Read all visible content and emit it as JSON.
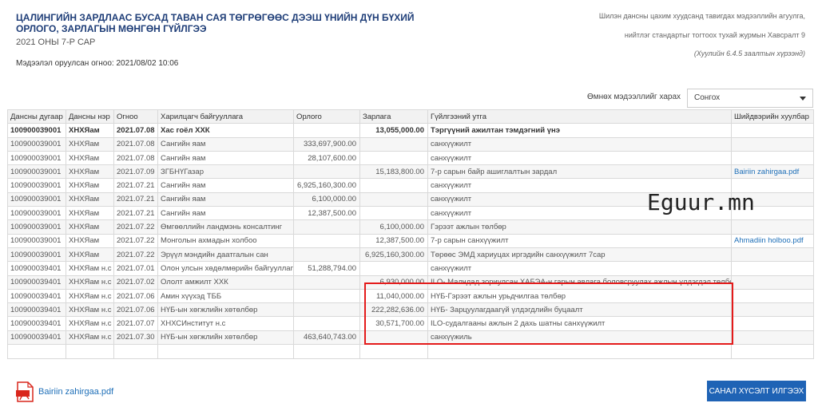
{
  "header": {
    "title": "ЦАЛИНГИЙН ЗАРДЛААС БУСАД ТАВАН САЯ ТӨГРӨГӨӨС ДЭЭШ ҮНИЙН ДҮН БҮХИЙ ОРЛОГО, ЗАРЛАГЫН МӨНГӨН ГҮЙЛГЭЭ",
    "period": "2021 ОНЫ 7-Р САР",
    "entered_date": "Мэдээлэл оруулсан огноо: 2021/08/02 10:06"
  },
  "notes": {
    "line1": "Шилэн дансны цахим хуудсанд тавигдах мэдээллийн агуулга,",
    "line2": "нийтлэг стандартыг тогтоох тухай журмын Хавсралт 9",
    "line3": "(Хуулийн 6.4.5 заалтын хүрээнд)"
  },
  "filter": {
    "label": "Өмнөх мэдээллийг харах",
    "selected": "Сонгох"
  },
  "table": {
    "columns": [
      "Дансны дугаар",
      "Дансны нэр",
      "Огноо",
      "Харилцагч байгууллага",
      "Орлого",
      "Зарлага",
      "Гүйлгээний утга",
      "Шийдвэрийн хуулбар"
    ],
    "rows": [
      {
        "acct": "100900039001",
        "name": "ХНХЯам",
        "date": "2021.07.08",
        "party": "Хас гоёл ХХК",
        "income": "",
        "expense": "13,055,000.00",
        "desc": "Тэргүүний ажилтан тэмдэгний үнэ",
        "doc": ""
      },
      {
        "acct": "100900039001",
        "name": "ХНХЯам",
        "date": "2021.07.08",
        "party": "Сангийн яам",
        "income": "333,697,900.00",
        "expense": "",
        "desc": "санхүүжилт",
        "doc": ""
      },
      {
        "acct": "100900039001",
        "name": "ХНХЯам",
        "date": "2021.07.08",
        "party": "Сангийн яам",
        "income": "28,107,600.00",
        "expense": "",
        "desc": "санхүүжилт",
        "doc": ""
      },
      {
        "acct": "100900039001",
        "name": "ХНХЯам",
        "date": "2021.07.09",
        "party": "ЗГБНҮГазар",
        "income": "",
        "expense": "15,183,800.00",
        "desc": "7-р сарын байр ашиглалтын зардал",
        "doc": "Bairiin zahirgaa.pdf"
      },
      {
        "acct": "100900039001",
        "name": "ХНХЯам",
        "date": "2021.07.21",
        "party": "Сангийн яам",
        "income": "6,925,160,300.00",
        "expense": "",
        "desc": "санхүүжилт",
        "doc": ""
      },
      {
        "acct": "100900039001",
        "name": "ХНХЯам",
        "date": "2021.07.21",
        "party": "Сангийн яам",
        "income": "6,100,000.00",
        "expense": "",
        "desc": "санхүүжилт",
        "doc": ""
      },
      {
        "acct": "100900039001",
        "name": "ХНХЯам",
        "date": "2021.07.21",
        "party": "Сангийн яам",
        "income": "12,387,500.00",
        "expense": "",
        "desc": "санхүүжилт",
        "doc": ""
      },
      {
        "acct": "100900039001",
        "name": "ХНХЯам",
        "date": "2021.07.22",
        "party": "Өмгөөллийн ландмэнь консалтинг",
        "income": "",
        "expense": "6,100,000.00",
        "desc": "Гэрээт ажлын төлбөр",
        "doc": ""
      },
      {
        "acct": "100900039001",
        "name": "ХНХЯам",
        "date": "2021.07.22",
        "party": "Монголын ахмадын холбоо",
        "income": "",
        "expense": "12,387,500.00",
        "desc": "7-р сарын санхүүжилт",
        "doc": "Ahmadiin holboo.pdf"
      },
      {
        "acct": "100900039001",
        "name": "ХНХЯам",
        "date": "2021.07.22",
        "party": "Эрүүл мэндийн даатгалын сан",
        "income": "",
        "expense": "6,925,160,300.00",
        "desc": "Төрөөс ЭМД хариуцах иргэдийн санхүүжилт 7сар",
        "doc": ""
      },
      {
        "acct": "100900039401",
        "name": "ХНХЯам н.с",
        "date": "2021.07.01",
        "party": "Олон улсын хөдөлмөрийн байгууллага",
        "income": "51,288,794.00",
        "expense": "",
        "desc": "санхүүжилт",
        "doc": ""
      },
      {
        "acct": "100900039401",
        "name": "ХНХЯам н.с",
        "date": "2021.07.02",
        "party": "Ололт амжилт ХХК",
        "income": "",
        "expense": "6,930,000.00",
        "desc": "ILO- Малчдад зориулсан ХАБЭА-н гарын авлага боловсруулах ажлын үлдэгдэл төлбөр",
        "doc": ""
      },
      {
        "acct": "100900039401",
        "name": "ХНХЯам н.с",
        "date": "2021.07.06",
        "party": "Амин хүүхэд ТББ",
        "income": "",
        "expense": "11,040,000.00",
        "desc": "НҮБ-Гэрээт ажлын урьдчилгаа төлбөр",
        "doc": ""
      },
      {
        "acct": "100900039401",
        "name": "ХНХЯам н.с",
        "date": "2021.07.06",
        "party": "НҮБ-ын хөгжлийн хөтөлбөр",
        "income": "",
        "expense": "222,282,636.00",
        "desc": "НҮБ- Зарцуулагдаагүй үлдэгдлийн буцаалт",
        "doc": ""
      },
      {
        "acct": "100900039401",
        "name": "ХНХЯам н.с",
        "date": "2021.07.07",
        "party": "ХНХСИнститут н.с",
        "income": "",
        "expense": "30,571,700.00",
        "desc": "ILO-судалгааны ажлын 2 дахь шатны санхүүжилт",
        "doc": ""
      },
      {
        "acct": "100900039401",
        "name": "ХНХЯам н.с",
        "date": "2021.07.30",
        "party": "НҮБ-ын хөгжлийн хөтөлбөр",
        "income": "463,640,743.00",
        "expense": "",
        "desc": "санхүүжиль",
        "doc": ""
      }
    ]
  },
  "watermark": "Eguur.mn",
  "footer": {
    "pdf_link": "Bairiin zahirgaa.pdf",
    "submit_label": "САНАЛ ХҮСЭЛТ ИЛГЭЭХ"
  },
  "colors": {
    "title": "#1f3e78",
    "link": "#1e6fb8",
    "button": "#1f63b5",
    "highlight": "#e41b1b",
    "pdf_icon": "#d9261c"
  },
  "icons": {
    "pdf": "pdf-file-icon",
    "select": "chevron-down-icon"
  }
}
